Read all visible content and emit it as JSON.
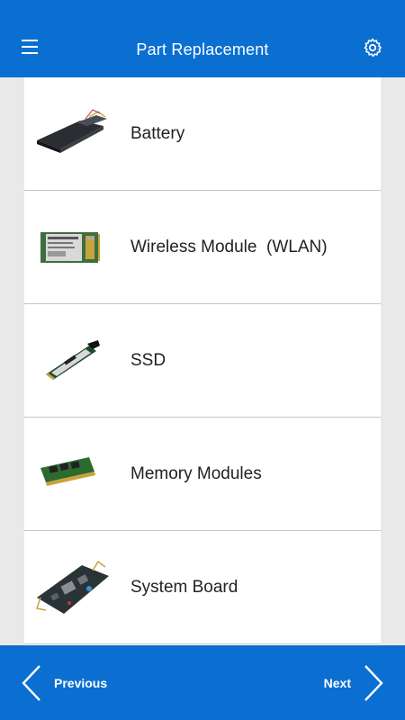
{
  "header": {
    "title": "Part Replacement",
    "menu_icon": "hamburger-menu-icon",
    "settings_icon": "gear-icon"
  },
  "parts": [
    {
      "label": "Battery",
      "image": "battery-image"
    },
    {
      "label": "Wireless Module  (WLAN)",
      "image": "wlan-card-image"
    },
    {
      "label": "SSD",
      "image": "ssd-image"
    },
    {
      "label": "Memory Modules",
      "image": "memory-module-image"
    },
    {
      "label": "System Board",
      "image": "system-board-image"
    }
  ],
  "footer": {
    "previous_label": "Previous",
    "next_label": "Next"
  },
  "colors": {
    "primary": "#0a6fd1",
    "background": "#e9e9e9",
    "divider": "#c6c6c6"
  }
}
